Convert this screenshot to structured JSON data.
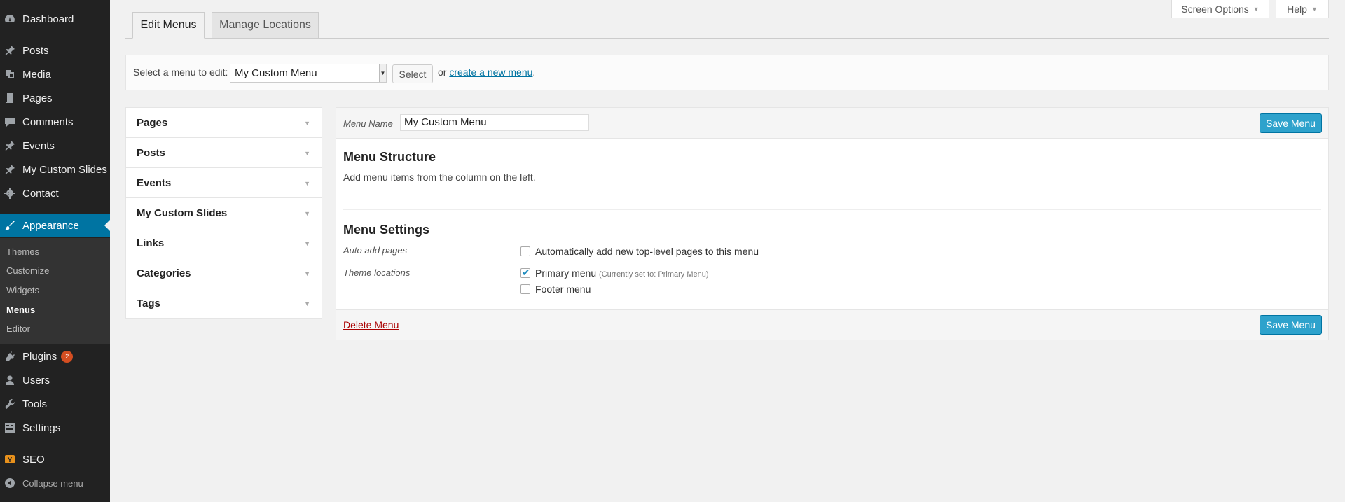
{
  "sidebar": {
    "items": [
      {
        "label": "Dashboard",
        "icon": "dashboard-icon"
      },
      {
        "label": "Posts",
        "icon": "pin-icon"
      },
      {
        "label": "Media",
        "icon": "media-icon"
      },
      {
        "label": "Pages",
        "icon": "pages-icon"
      },
      {
        "label": "Comments",
        "icon": "comment-icon"
      },
      {
        "label": "Events",
        "icon": "pin-icon"
      },
      {
        "label": "My Custom Slides",
        "icon": "pin-icon"
      },
      {
        "label": "Contact",
        "icon": "gear-icon"
      },
      {
        "label": "Appearance",
        "icon": "brush-icon"
      },
      {
        "label": "Plugins",
        "icon": "plugin-icon",
        "badge": "2"
      },
      {
        "label": "Users",
        "icon": "user-icon"
      },
      {
        "label": "Tools",
        "icon": "wrench-icon"
      },
      {
        "label": "Settings",
        "icon": "settings-icon"
      },
      {
        "label": "SEO",
        "icon": "seo-icon"
      }
    ],
    "submenu": [
      "Themes",
      "Customize",
      "Widgets",
      "Menus",
      "Editor"
    ],
    "collapse_label": "Collapse menu"
  },
  "top": {
    "screen_options": "Screen Options",
    "help": "Help"
  },
  "tabs": {
    "edit": "Edit Menus",
    "locations": "Manage Locations"
  },
  "select_bar": {
    "label": "Select a menu to edit:",
    "selected": "My Custom Menu",
    "select_btn": "Select",
    "or": "or",
    "create_link": "create a new menu",
    "period": "."
  },
  "accordion": [
    "Pages",
    "Posts",
    "Events",
    "My Custom Slides",
    "Links",
    "Categories",
    "Tags"
  ],
  "manage": {
    "menu_name_label": "Menu Name",
    "menu_name_value": "My Custom Menu",
    "save": "Save Menu",
    "structure_title": "Menu Structure",
    "structure_desc": "Add menu items from the column on the left.",
    "settings_title": "Menu Settings",
    "auto_add_label": "Auto add pages",
    "auto_add_text": "Automatically add new top-level pages to this menu",
    "theme_locations_label": "Theme locations",
    "primary_menu": "Primary menu",
    "primary_note": "(Currently set to: Primary Menu)",
    "footer_menu": "Footer menu",
    "delete": "Delete Menu"
  },
  "colors": {
    "sidebar_bg": "#222222",
    "active_bg": "#0074a2",
    "primary_btn": "#2ea2cc",
    "badge": "#d54e21",
    "delete_link": "#aa0000"
  }
}
